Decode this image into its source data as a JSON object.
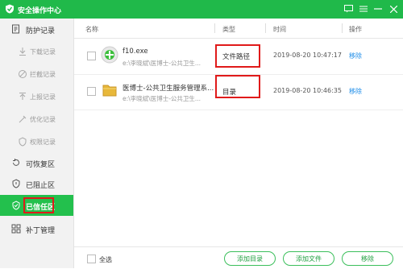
{
  "window": {
    "title": "安全操作中心"
  },
  "sidebar": {
    "items": [
      {
        "label": "防护记录",
        "icon": "shield-record-icon"
      },
      {
        "label": "下载记录",
        "icon": "download-icon"
      },
      {
        "label": "拦截记录",
        "icon": "block-icon"
      },
      {
        "label": "上报记录",
        "icon": "upload-icon"
      },
      {
        "label": "优化记录",
        "icon": "optimize-icon"
      },
      {
        "label": "权限记录",
        "icon": "permission-icon"
      },
      {
        "label": "可恢复区",
        "icon": "restore-icon"
      },
      {
        "label": "已阻止区",
        "icon": "blocked-shield-icon"
      },
      {
        "label": "已信任区",
        "icon": "trusted-shield-icon"
      },
      {
        "label": "补丁管理",
        "icon": "patch-icon"
      }
    ],
    "active_index": 8
  },
  "table": {
    "headers": [
      "名称",
      "类型",
      "时间",
      "操作"
    ],
    "rows": [
      {
        "name": "f10.exe",
        "path": "e:\\李晓斌\\医博士-公共卫生...",
        "type": "文件路径",
        "time": "2019-08-20 10:47:17",
        "action": "移除",
        "icon": "exe-file-icon"
      },
      {
        "name": "医博士-公共卫生服务管理系...",
        "path": "e:\\李晓斌\\医博士-公共卫生...",
        "type": "目录",
        "time": "2019-08-20 10:46:35",
        "action": "移除",
        "icon": "folder-icon"
      }
    ]
  },
  "footer": {
    "select_all": "全选",
    "add_dir": "添加目录",
    "add_file": "添加文件",
    "remove": "移除"
  },
  "colors": {
    "brand": "#20b94a",
    "active": "#23c04d",
    "highlight": "#e01a1a",
    "link": "#1e8de8"
  }
}
